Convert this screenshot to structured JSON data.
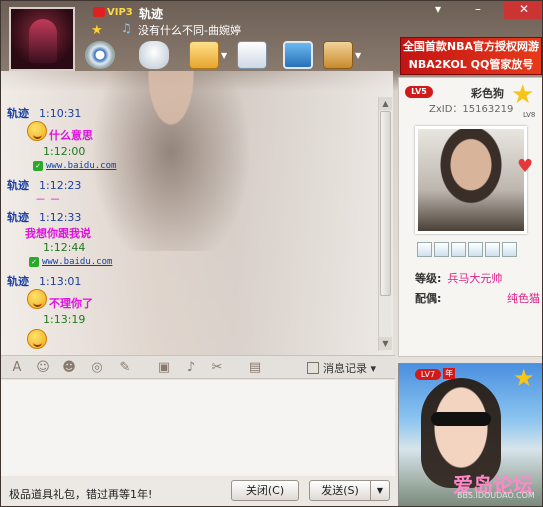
{
  "window": {
    "controls": [
      "▾",
      "–",
      "✕"
    ]
  },
  "profile": {
    "vip_level": "VIP3",
    "nickname": "轨迹",
    "signature": "没有什么不同-曲婉婷"
  },
  "ad_banner": {
    "line1": "全国首款NBA官方授权网游",
    "line2": "NBA2KOL QQ管家放号"
  },
  "messages": [
    {
      "sender": "轨迹",
      "time": "1:10:31",
      "text": "什么意思"
    },
    {
      "time": "1:12:00",
      "link": "www.baidu.com"
    },
    {
      "sender": "轨迹",
      "time": "1:12:23",
      "dash": "－ －"
    },
    {
      "sender": "轨迹",
      "time": "1:12:33",
      "text": "我想你跟我说"
    },
    {
      "time": "1:12:44",
      "link": "www.baidu.com"
    },
    {
      "sender": "轨迹",
      "time": "1:13:01",
      "text": "不理你了"
    },
    {
      "time": "1:13:19"
    }
  ],
  "input_toolbar": {
    "history_label": "消息记录",
    "history_caret": "▾"
  },
  "bottom": {
    "promo": "极品道具礼包，错过再等1年!",
    "close_label": "关闭(C)",
    "send_label": "发送(S)",
    "send_dropdown": "▼"
  },
  "right_panel": {
    "level_badge": "LV5",
    "name": "彩色狗",
    "zxid": "ZxID：15163219",
    "star_level": "LV8",
    "rank_label": "等级:",
    "rank_value": "兵马大元帅",
    "spouse_label": "配偶:",
    "spouse_value": "纯色猫"
  },
  "video_panel": {
    "level_badge": "LV7",
    "tag": "年"
  },
  "watermark": {
    "text": "爱岛论坛",
    "sub": "BBS.IDOUDAO.COM"
  }
}
